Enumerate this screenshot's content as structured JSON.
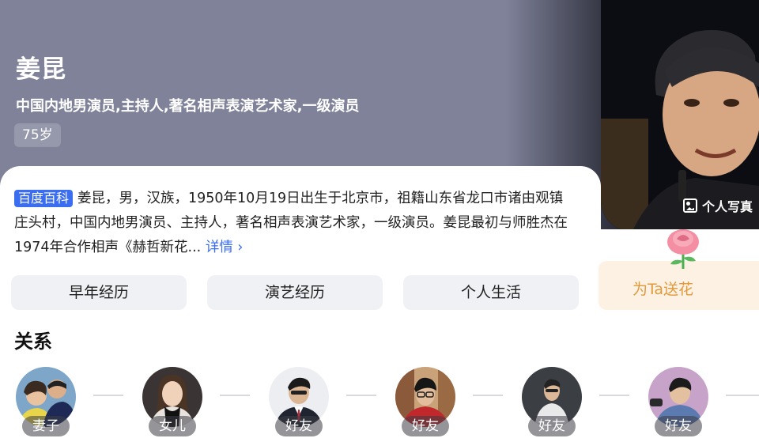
{
  "profile": {
    "name": "姜昆",
    "subtitle": "中国内地男演员,主持人,著名相声表演艺术家,一级演员",
    "age": "75岁",
    "photo_label": "个人写真"
  },
  "intro": {
    "badge": "百度百科",
    "text": "姜昆，男，汉族，1950年10月19日出生于北京市，祖籍山东省龙口市诸由观镇庄头村，中国内地男演员、主持人，著名相声表演艺术家，一级演员。姜昆最初与师胜杰在1974年合作相声《赫哲新花...",
    "more": "详情 ›"
  },
  "tabs": [
    "早年经历",
    "演艺经历",
    "个人生活"
  ],
  "flower_button": "为Ta送花",
  "relations": {
    "title": "关系",
    "items": [
      {
        "role": "妻子",
        "icon": "wife-avatar"
      },
      {
        "role": "女儿",
        "icon": "daughter-avatar"
      },
      {
        "role": "好友",
        "icon": "friend-avatar"
      },
      {
        "role": "好友",
        "icon": "friend-avatar"
      },
      {
        "role": "好友",
        "icon": "friend-avatar"
      },
      {
        "role": "好友",
        "icon": "friend-avatar"
      }
    ]
  },
  "colors": {
    "hero_bg": "#7f8299",
    "accent_blue": "#3a6df0",
    "flower_text": "#e09a3a",
    "flower_bg": "#fdf1e4"
  }
}
